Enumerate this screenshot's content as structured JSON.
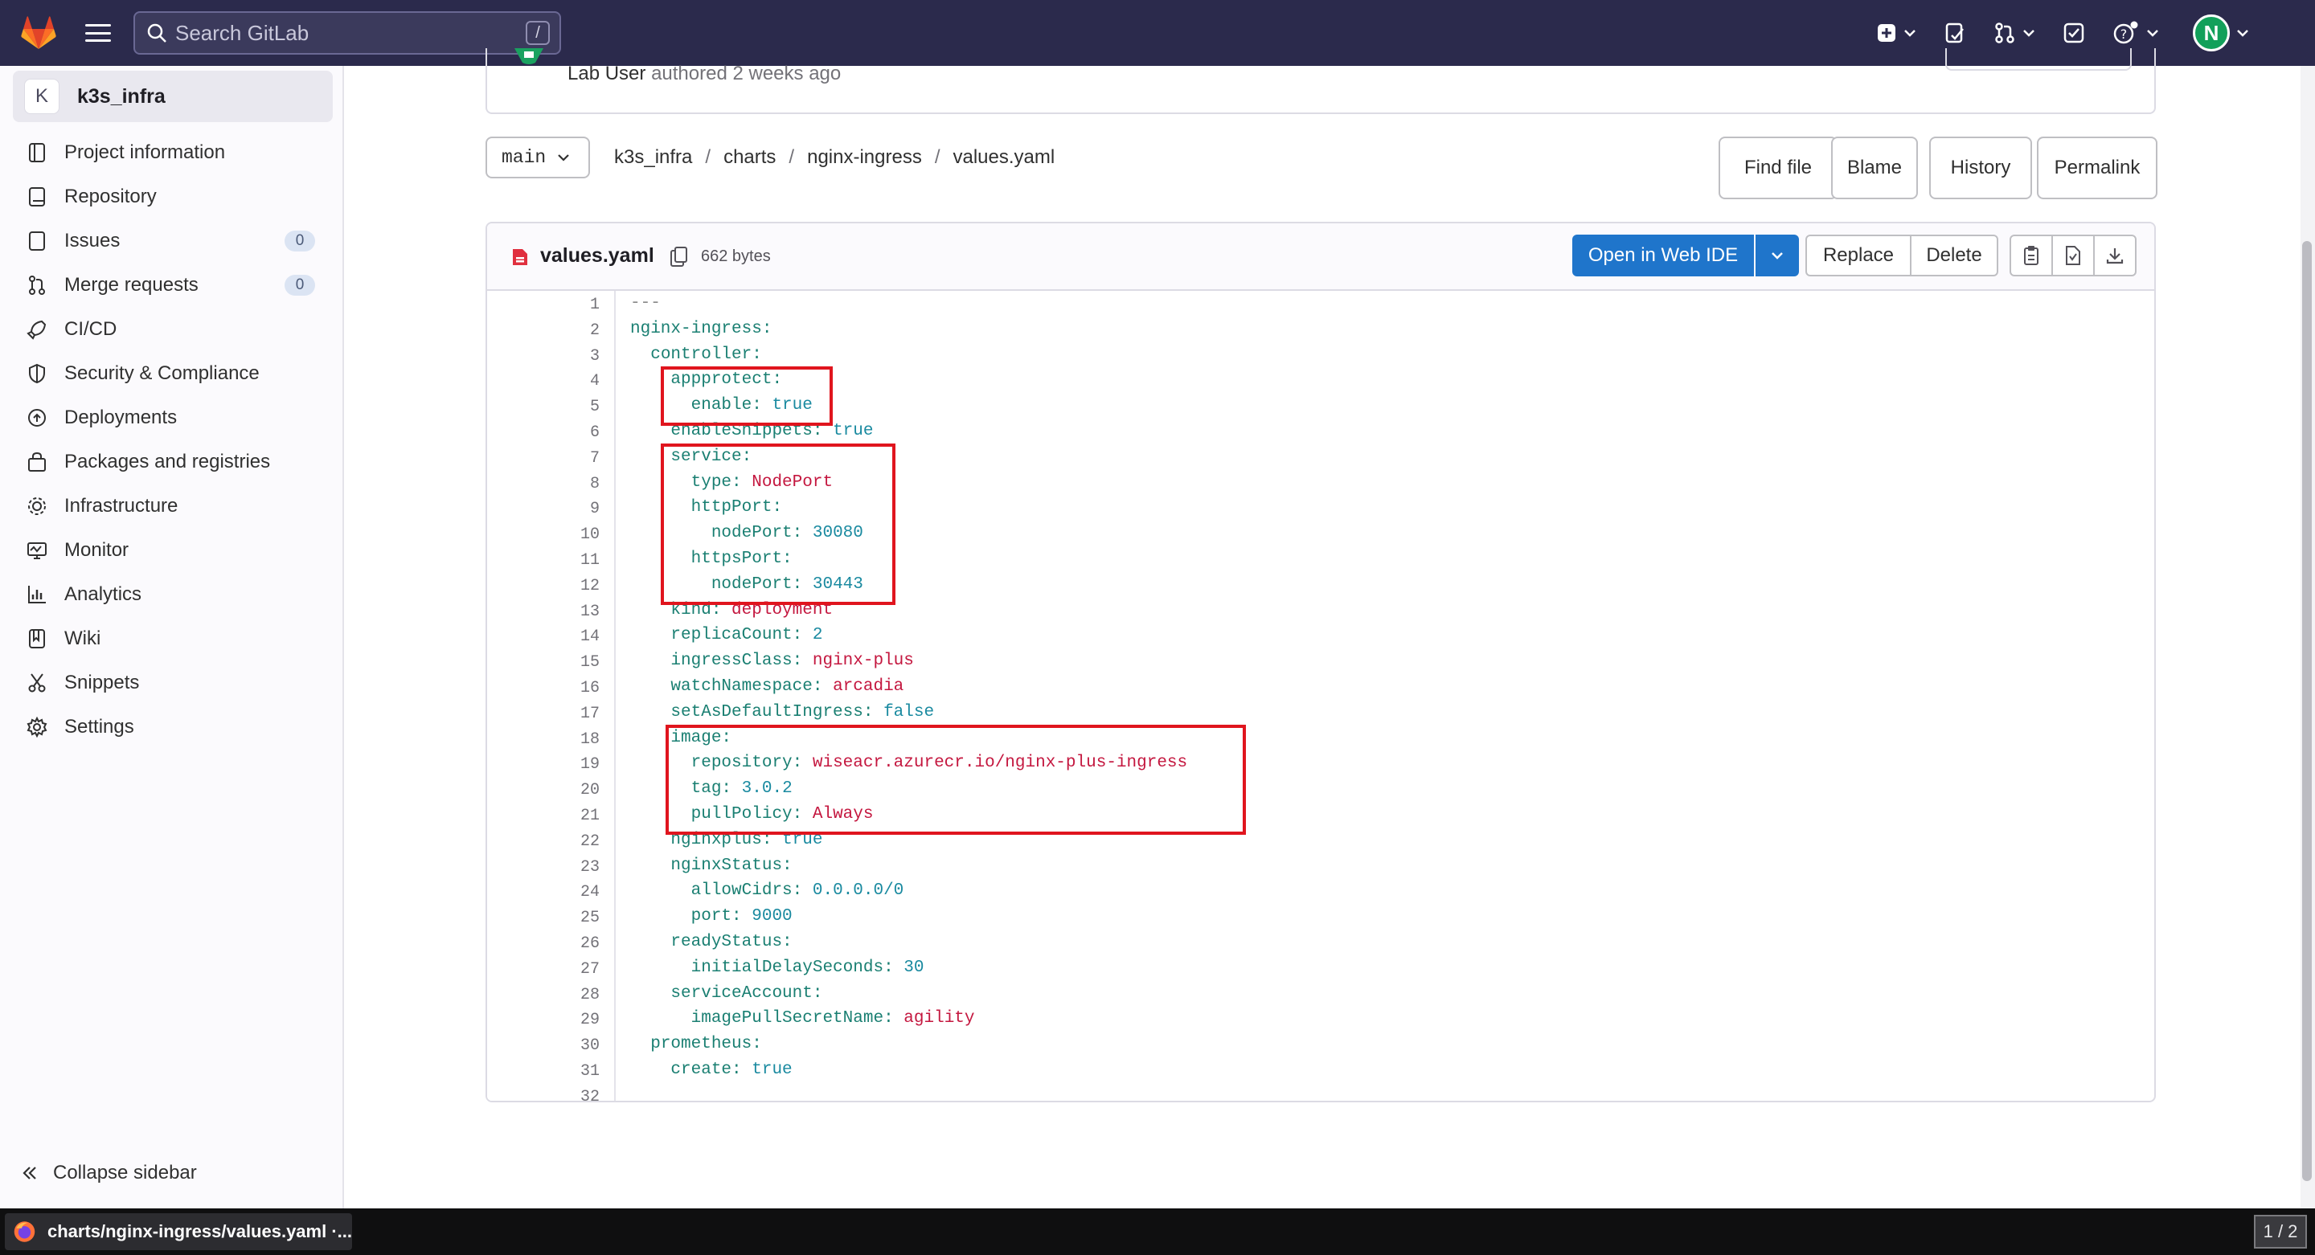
{
  "navbar": {
    "search_placeholder": "Search GitLab",
    "search_shortcut": "/",
    "avatar_initial": "N"
  },
  "sidebar": {
    "project_initial": "K",
    "project_name": "k3s_infra",
    "items": [
      {
        "label": "Project information",
        "icon": "project-info-icon"
      },
      {
        "label": "Repository",
        "icon": "repository-icon"
      },
      {
        "label": "Issues",
        "icon": "issues-icon",
        "badge": "0"
      },
      {
        "label": "Merge requests",
        "icon": "merge-request-icon",
        "badge": "0"
      },
      {
        "label": "CI/CD",
        "icon": "rocket-icon"
      },
      {
        "label": "Security & Compliance",
        "icon": "shield-icon"
      },
      {
        "label": "Deployments",
        "icon": "deployments-icon"
      },
      {
        "label": "Packages and registries",
        "icon": "package-icon"
      },
      {
        "label": "Infrastructure",
        "icon": "cloud-gear-icon"
      },
      {
        "label": "Monitor",
        "icon": "monitor-icon"
      },
      {
        "label": "Analytics",
        "icon": "chart-icon"
      },
      {
        "label": "Wiki",
        "icon": "book-icon"
      },
      {
        "label": "Snippets",
        "icon": "scissors-icon"
      },
      {
        "label": "Settings",
        "icon": "gear-icon"
      }
    ],
    "collapse_label": "Collapse sidebar"
  },
  "commit": {
    "author": "Lab User",
    "suffix": "authored 2 weeks ago"
  },
  "tree": {
    "branch": "main",
    "breadcrumb": [
      "k3s_infra",
      "charts",
      "nginx-ingress",
      "values.yaml"
    ],
    "buttons": {
      "find_file": "Find file",
      "blame": "Blame",
      "history": "History",
      "permalink": "Permalink"
    }
  },
  "file": {
    "name": "values.yaml",
    "size": "662 bytes",
    "open_ide": "Open in Web IDE",
    "replace": "Replace",
    "delete": "Delete"
  },
  "code_lines": [
    "---",
    "nginx-ingress:",
    "  controller:",
    "    appprotect:",
    "      enable: true",
    "    enableSnippets: true",
    "    service:",
    "      type: NodePort",
    "      httpPort:",
    "        nodePort: 30080",
    "      httpsPort:",
    "        nodePort: 30443",
    "    kind: deployment",
    "    replicaCount: 2",
    "    ingressClass: nginx-plus",
    "    watchNamespace: arcadia",
    "    setAsDefaultIngress: false",
    "    image:",
    "      repository: wiseacr.azurecr.io/nginx-plus-ingress",
    "      tag: 3.0.2",
    "      pullPolicy: Always",
    "    nginxplus: true",
    "    nginxStatus:",
    "      allowCidrs: 0.0.0.0/0",
    "      port: 9000",
    "    readyStatus:",
    "      initialDelaySeconds: 30",
    "    serviceAccount:",
    "      imagePullSecretName: agility",
    "  prometheus:",
    "    create: true",
    ""
  ],
  "highlights": [
    [
      4,
      5
    ],
    [
      7,
      12
    ],
    [
      18,
      21
    ]
  ],
  "highlight_color": "#e0151e",
  "taskbar": {
    "window_title": "charts/nginx-ingress/values.yaml ·...",
    "pager": "1 / 2"
  },
  "colors": {
    "navbar": "#2b2a4c",
    "primary": "#1f75cb",
    "key": "#1a7f72",
    "string": "#c4173f",
    "number": "#1a8aa0"
  }
}
